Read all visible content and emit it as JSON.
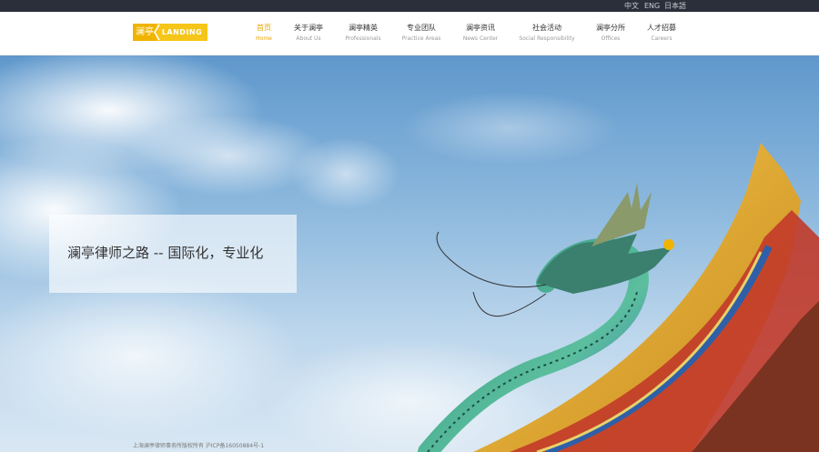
{
  "languages": [
    {
      "label": "中文"
    },
    {
      "label": "ENG"
    },
    {
      "label": "日本語"
    }
  ],
  "logo": {
    "cn": "澜亭",
    "en": "LANDING"
  },
  "nav": [
    {
      "cn": "首页",
      "en": "Home"
    },
    {
      "cn": "关于澜亭",
      "en": "About Us"
    },
    {
      "cn": "澜亭精英",
      "en": "Professionals"
    },
    {
      "cn": "专业团队",
      "en": "Practice Areas"
    },
    {
      "cn": "澜亭资讯",
      "en": "News Center"
    },
    {
      "cn": "社会活动",
      "en": "Social Responsibility"
    },
    {
      "cn": "澜亭分所",
      "en": "Offices"
    },
    {
      "cn": "人才招募",
      "en": "Careers"
    }
  ],
  "hero": {
    "slogan": "澜亭律师之路 -- 国际化，专业化"
  },
  "footer": {
    "copyright": "上海澜亭律师事务所版权所有 沪ICP备16050884号-1"
  },
  "colors": {
    "accent": "#e8a600",
    "logo_yellow": "#f5c518",
    "topbar": "#2b2f3a"
  }
}
